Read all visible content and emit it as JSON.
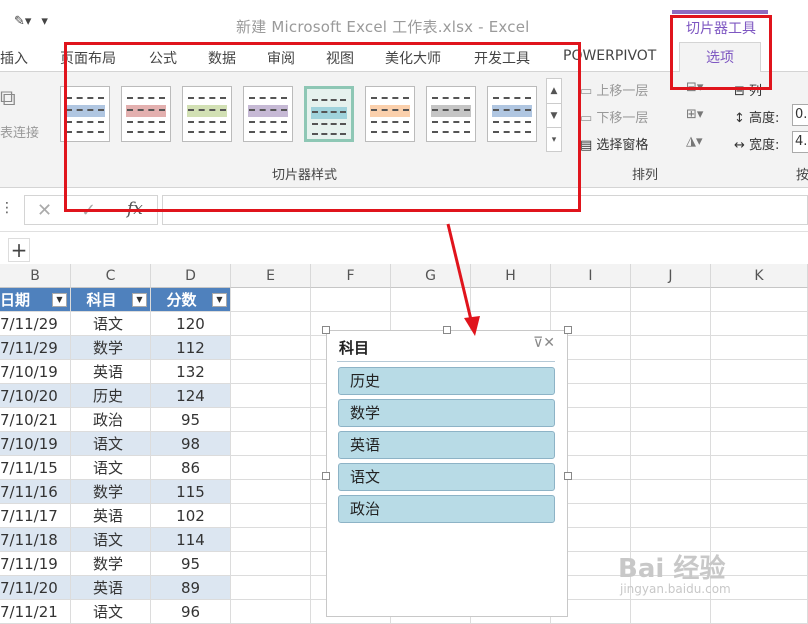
{
  "window": {
    "title": "新建 Microsoft Excel 工作表.xlsx - Excel",
    "context_tab_group": "切片器工具"
  },
  "ribbon_tabs": [
    "插入",
    "页面布局",
    "公式",
    "数据",
    "审阅",
    "视图",
    "美化大师",
    "开发工具",
    "POWERPIVOT",
    "选项"
  ],
  "ribbon": {
    "left_group_label": "表连接",
    "styles_group_label": "切片器样式",
    "arrange_group_label": "排列",
    "arrange_items": [
      "上移一层",
      "下移一层",
      "选择窗格"
    ],
    "size_items": [
      "列",
      "高度:",
      "宽度:"
    ],
    "size_values": [
      "0.",
      "4."
    ],
    "cut_label": "按",
    "style_colors": [
      "#4f81bd",
      "#c0504d",
      "#9bbb59",
      "#8064a2",
      "#4bacc6",
      "#f79646",
      "#7f7f7f",
      "#4f81bd"
    ]
  },
  "formula_bar": {
    "fx_label": "fx",
    "value": ""
  },
  "sheet": {
    "add_sheet_label": "+",
    "columns": [
      "B",
      "C",
      "D",
      "E",
      "F",
      "G",
      "H",
      "I",
      "J",
      "K"
    ],
    "headers": [
      "日期",
      "科目",
      "分数"
    ],
    "rows": [
      [
        "7/11/29",
        "语文",
        "120"
      ],
      [
        "7/11/29",
        "数学",
        "112"
      ],
      [
        "7/10/19",
        "英语",
        "132"
      ],
      [
        "7/10/20",
        "历史",
        "124"
      ],
      [
        "7/10/21",
        "政治",
        "95"
      ],
      [
        "7/10/19",
        "语文",
        "98"
      ],
      [
        "7/11/15",
        "语文",
        "86"
      ],
      [
        "7/11/16",
        "数学",
        "115"
      ],
      [
        "7/11/17",
        "英语",
        "102"
      ],
      [
        "7/11/18",
        "语文",
        "114"
      ],
      [
        "7/11/19",
        "数学",
        "95"
      ],
      [
        "7/11/20",
        "英语",
        "89"
      ],
      [
        "7/11/21",
        "语文",
        "96"
      ]
    ]
  },
  "slicer": {
    "title": "科目",
    "items": [
      "历史",
      "数学",
      "英语",
      "语文",
      "政治"
    ]
  },
  "watermark": {
    "main": "Bai 经验",
    "sub": "jingyan.baidu.com"
  }
}
